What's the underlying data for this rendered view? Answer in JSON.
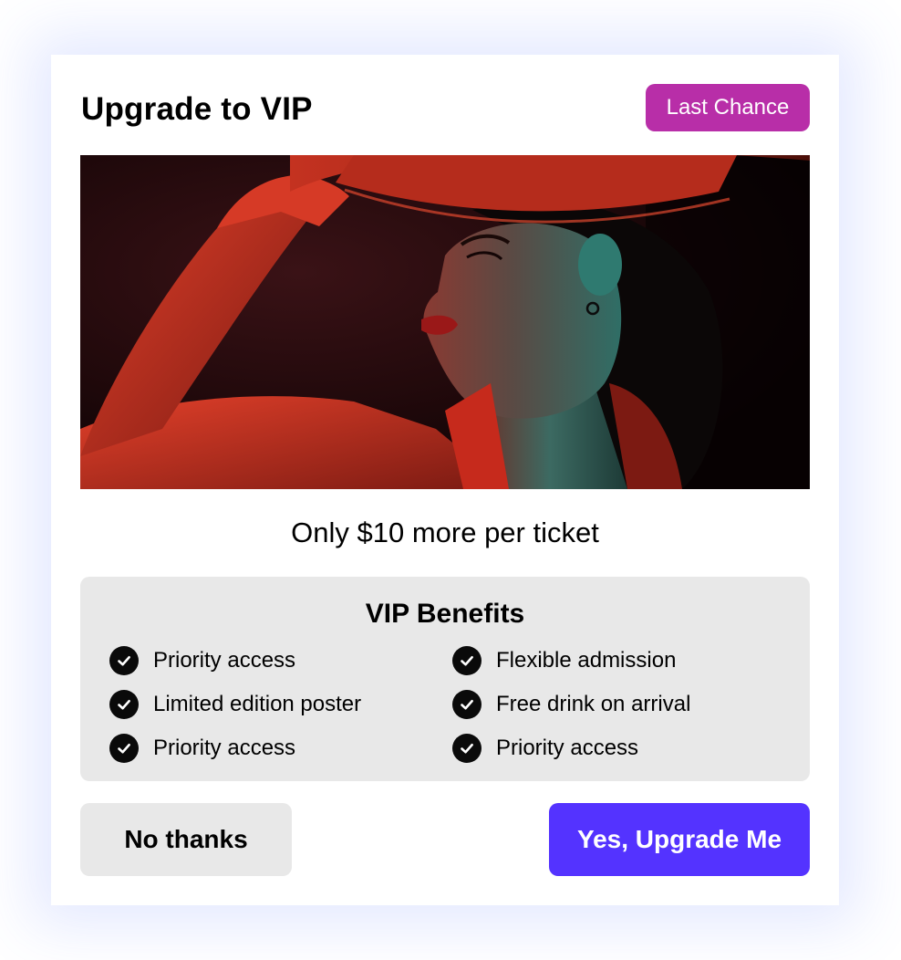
{
  "dialog": {
    "title": "Upgrade to VIP",
    "badge": "Last Chance",
    "price_text": "Only $10 more per ticket"
  },
  "benefits": {
    "title": "VIP Benefits",
    "icon": "checkmark-circle-icon",
    "items": [
      "Priority access",
      "Flexible admission",
      "Limited edition poster",
      "Free drink on arrival",
      "Priority access",
      "Priority access"
    ]
  },
  "actions": {
    "decline_label": "No thanks",
    "accept_label": "Yes, Upgrade Me"
  },
  "colors": {
    "badge": "#b82ea8",
    "primary": "#5433ff",
    "panel": "#e8e8e8"
  }
}
